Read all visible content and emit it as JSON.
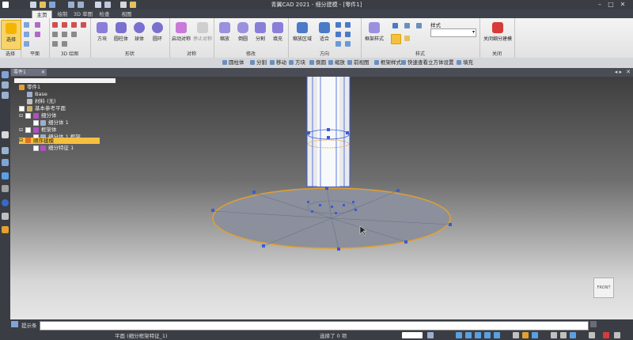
{
  "window": {
    "title": "青翼CAD 2021 - 细分建模 - [零件1]",
    "controls": [
      "–",
      "□",
      "✕"
    ]
  },
  "quick_access": [
    "new-icon",
    "open-icon",
    "save-icon",
    "undo-icon",
    "redo-icon",
    "settings-icon",
    "sketch-icon",
    "select-icon",
    "shape-icon",
    "dropdown-icon"
  ],
  "tabs": [
    {
      "label": "主页",
      "active": true
    },
    {
      "label": "绘制",
      "active": false
    },
    {
      "label": "3D 草图",
      "active": false
    },
    {
      "label": "检查",
      "active": false
    },
    {
      "label": "视图",
      "active": false
    }
  ],
  "ribbon": {
    "groups": [
      {
        "caption": "选择",
        "buttons": [
          {
            "label": "选择",
            "icon": "cursor-icon"
          }
        ]
      },
      {
        "caption": "平面",
        "buttons": []
      },
      {
        "caption": "3D 绘图",
        "buttons": []
      },
      {
        "caption": "形状",
        "buttons": [
          {
            "label": "方块",
            "icon": "box-icon"
          },
          {
            "label": "圆柱体",
            "icon": "cylinder-icon"
          },
          {
            "label": "球体",
            "icon": "sphere-icon"
          },
          {
            "label": "圆环",
            "icon": "torus-icon"
          }
        ]
      },
      {
        "caption": "对称",
        "buttons": [
          {
            "label": "启动对称",
            "icon": "symmetry-icon"
          },
          {
            "label": "停止对称",
            "icon": "stop-symmetry-icon"
          }
        ]
      },
      {
        "caption": "修改",
        "buttons": [
          {
            "label": "缩放",
            "icon": "scale-icon"
          },
          {
            "label": "倒圆",
            "icon": "round-icon"
          },
          {
            "label": "分割",
            "icon": "split-icon"
          },
          {
            "label": "填充",
            "icon": "fill-icon"
          }
        ]
      },
      {
        "caption": "方向",
        "buttons": [
          {
            "label": "缩放区域",
            "icon": "zoom-area-icon"
          },
          {
            "label": "适合",
            "icon": "fit-icon"
          }
        ]
      },
      {
        "caption": "样式",
        "buttons": [
          {
            "label": "框架样式",
            "icon": "frame-style-icon"
          }
        ],
        "style_label": "样式"
      },
      {
        "caption": "关闭",
        "buttons": [
          {
            "label": "关闭细分建模",
            "icon": "close-subdivision-icon"
          }
        ]
      }
    ]
  },
  "strip": [
    "圆柱体",
    "分割",
    "移动",
    "方块",
    "倒圆",
    "缩放",
    "前视图",
    "框架样式",
    "快速查看立方体设置",
    "填充"
  ],
  "doc": {
    "tab": "零件1"
  },
  "tree": [
    {
      "label": "零件1",
      "level": 0,
      "checked": false,
      "selected": false
    },
    {
      "label": "Base",
      "level": 1,
      "checked": false,
      "selected": false
    },
    {
      "label": "材料 (无)",
      "level": 1,
      "checked": false,
      "selected": false
    },
    {
      "label": "基本参考平面",
      "level": 1,
      "checked": false,
      "selected": false
    },
    {
      "label": "细分体",
      "level": 1,
      "checked": true,
      "selected": false
    },
    {
      "label": "细分体 1",
      "level": 2,
      "checked": true,
      "selected": false
    },
    {
      "label": "框架体",
      "level": 1,
      "checked": true,
      "selected": false
    },
    {
      "label": "细分体 1 框架",
      "level": 2,
      "checked": true,
      "selected": false
    },
    {
      "label": "顺序建模",
      "level": 0,
      "checked": false,
      "selected": true
    },
    {
      "label": "细分特征 1",
      "level": 1,
      "checked": true,
      "selected": false
    }
  ],
  "viewcube": {
    "label": "FRONT"
  },
  "command": {
    "label": "提示条",
    "value": ""
  },
  "status": {
    "left": "平面 (细分框架特征_1)",
    "center": "选择了 0 项"
  },
  "colors": {
    "accent": "#3c5bd6",
    "edge": "#e0a030",
    "ribbon": "#ececec",
    "dark": "#3a3d44"
  }
}
